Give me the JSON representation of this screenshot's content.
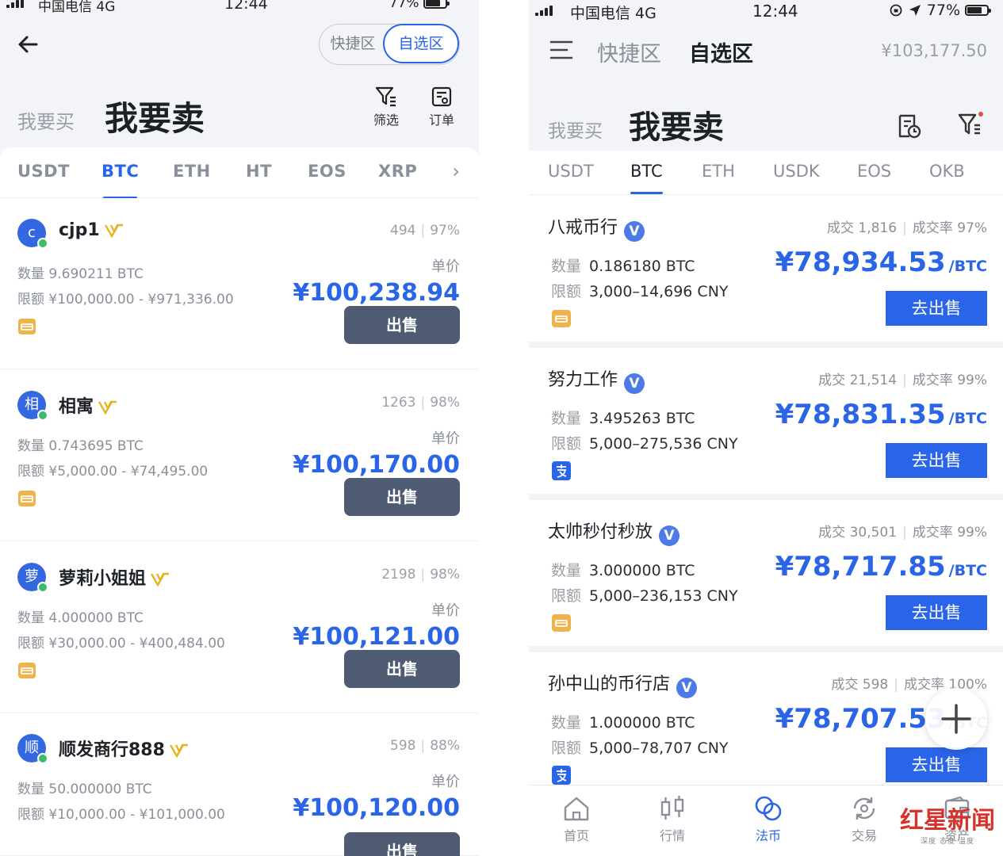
{
  "left": {
    "status": {
      "carrier": "中国电信  4G",
      "time": "12:44",
      "battery": "77%"
    },
    "segments": [
      "快捷区",
      "自选区"
    ],
    "buy_tab": "我要买",
    "sell_tab": "我要卖",
    "filter_label": "筛选",
    "orders_label": "订单",
    "coin_tabs": [
      "USDT",
      "BTC",
      "ETH",
      "HT",
      "EOS",
      "XRP"
    ],
    "unit_label": "单价",
    "sell_button": "出售",
    "ads": [
      {
        "avatar": "c",
        "name": "cjp1",
        "trades": "494",
        "rate": "97%",
        "qty": "数量 9.690211 BTC",
        "limit": "限额 ¥100,000.00 - ¥971,336.00",
        "price": "¥100,238.94"
      },
      {
        "avatar": "相",
        "name": "相寓",
        "trades": "1263",
        "rate": "98%",
        "qty": "数量 0.743695 BTC",
        "limit": "限额 ¥5,000.00 - ¥74,495.00",
        "price": "¥100,170.00"
      },
      {
        "avatar": "萝",
        "name": "萝莉小姐姐",
        "trades": "2198",
        "rate": "98%",
        "qty": "数量 4.000000 BTC",
        "limit": "限额 ¥30,000.00 - ¥400,484.00",
        "price": "¥100,121.00"
      },
      {
        "avatar": "顺",
        "name": "顺发商行888",
        "trades": "598",
        "rate": "88%",
        "qty": "数量 50.000000 BTC",
        "limit": "限额 ¥10,000.00 - ¥101,000.00",
        "price": "¥100,120.00"
      }
    ]
  },
  "right": {
    "status": {
      "carrier": "中国电信  4G",
      "time": "12:44",
      "battery": "77%"
    },
    "segments": [
      "快捷区",
      "自选区"
    ],
    "balance": "¥103,177.50",
    "buy_tab": "我要买",
    "sell_tab": "我要卖",
    "coin_tabs": [
      "USDT",
      "BTC",
      "ETH",
      "USDK",
      "EOS",
      "OKB"
    ],
    "qty_label": "数量",
    "limit_label": "限额",
    "price_unit": "/BTC",
    "sell_button": "去出售",
    "ads": [
      {
        "name": "八戒币行",
        "trades": "成交 1,816",
        "rate": "成交率 97%",
        "qty": "0.186180 BTC",
        "limit": "3,000–14,696 CNY",
        "price": "¥78,934.53",
        "pay": "bank"
      },
      {
        "name": "努力工作",
        "trades": "成交 21,514",
        "rate": "成交率 99%",
        "qty": "3.495263 BTC",
        "limit": "5,000–275,536 CNY",
        "price": "¥78,831.35",
        "pay": "alipay"
      },
      {
        "name": "太帅秒付秒放",
        "trades": "成交 30,501",
        "rate": "成交率 99%",
        "qty": "3.000000 BTC",
        "limit": "5,000–236,153 CNY",
        "price": "¥78,717.85",
        "pay": "bank"
      },
      {
        "name": "孙中山的币行店",
        "trades": "成交 598",
        "rate": "成交率 100%",
        "qty": "1.000000 BTC",
        "limit": "5,000–78,707 CNY",
        "price": "¥78,707.53",
        "pay": "alipay"
      }
    ],
    "nav": [
      "首页",
      "行情",
      "法币",
      "交易",
      "资产"
    ],
    "watermark": "红星新闻",
    "watermark_sub": "深度 态度 温度"
  },
  "colors": {
    "accent": "#2a64e8",
    "sell_button_left": "#4e5b73",
    "verified_gold": "#e6b422",
    "online_green": "#3dbb6b",
    "watermark_red": "#d7322c"
  }
}
